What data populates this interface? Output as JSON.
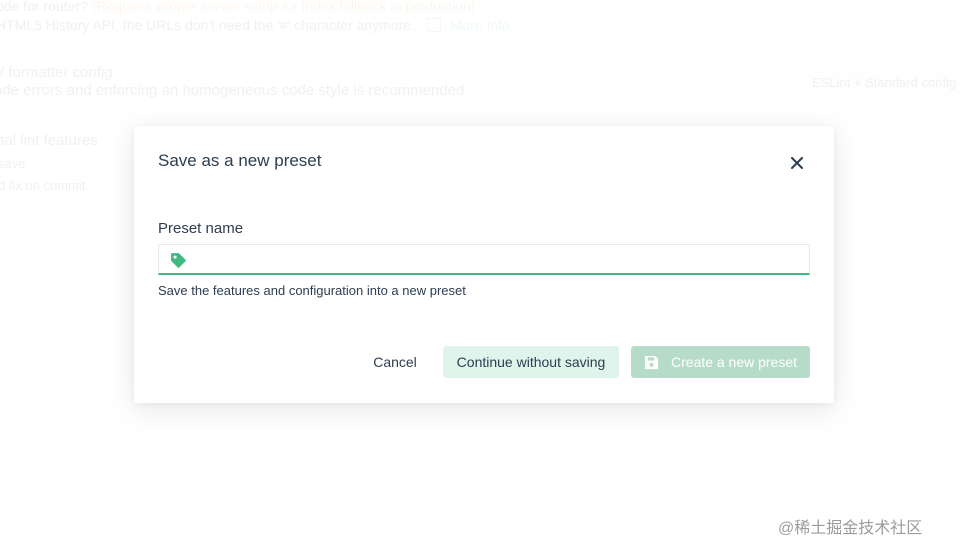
{
  "background": {
    "router_question": "ode for router?",
    "router_note": "(Requires proper server setup for index fallback in production)",
    "router_desc": "HTML5 History API, the URLs don't need the '#' character anymore.",
    "router_more": "More Info",
    "linter_title": "/ formatter config",
    "linter_desc": "ode errors and enforcing an homogeneous code style is recommended.",
    "linter_value": "ESLint + Standard config",
    "lint_features_title": "nal lint features",
    "lint_on_save": "save",
    "lint_on_commit": "d fix on commit"
  },
  "modal": {
    "title": "Save as a new preset",
    "close_icon": "close-icon",
    "field_label": "Preset name",
    "input_value": "",
    "input_icon": "tag-icon",
    "hint": "Save the features and configuration into a new preset",
    "cancel_label": "Cancel",
    "continue_label": "Continue without saving",
    "create_label": "Create a new preset",
    "create_icon": "save-icon"
  },
  "colors": {
    "accent": "#42b983",
    "continue_bg": "#dff5ec",
    "create_bg": "#b6dcc9",
    "text": "#2c3e50"
  },
  "watermark": "@稀土掘金技术社区"
}
